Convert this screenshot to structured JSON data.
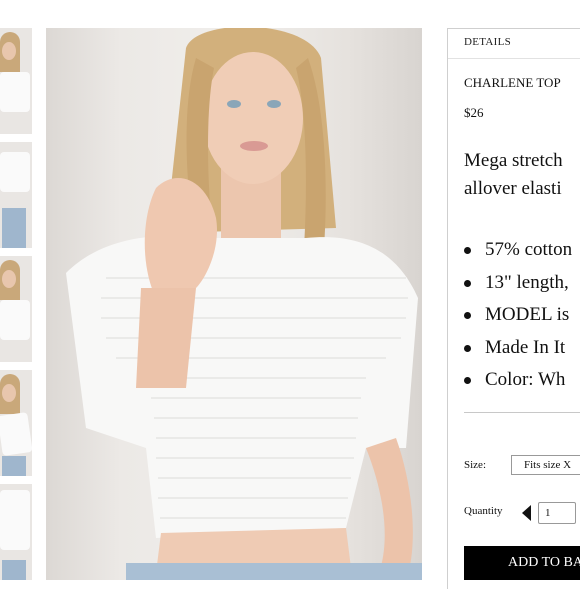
{
  "thumbnails": [
    {
      "label": "thumbnail 1"
    },
    {
      "label": "thumbnail 2"
    },
    {
      "label": "thumbnail 3"
    },
    {
      "label": "thumbnail 4"
    },
    {
      "label": "thumbnail 5"
    }
  ],
  "details_tab": "DETAILS",
  "product": {
    "name": "CHARLENE TOP",
    "price": "$26",
    "description_line1": "Mega stretch",
    "description_line2": "allover elasti",
    "bullets": [
      "57% cotton",
      "13\" length,",
      "MODEL is",
      "Made In It",
      "Color: Wh"
    ]
  },
  "size": {
    "label": "Size:",
    "selected": "Fits size X"
  },
  "quantity": {
    "label": "Quantity",
    "value": "1"
  },
  "add_to_bag": "ADD TO BA",
  "colors": {
    "button_bg": "#000000",
    "button_text": "#ffffff"
  }
}
